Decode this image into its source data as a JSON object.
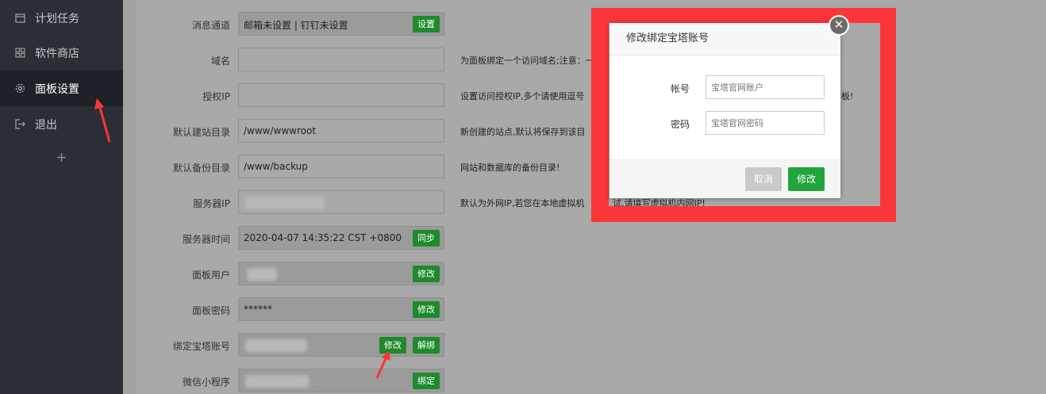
{
  "sidebar": {
    "items": [
      {
        "label": "计划任务",
        "icon": "calendar-icon"
      },
      {
        "label": "软件商店",
        "icon": "grid-icon"
      },
      {
        "label": "面板设置",
        "icon": "gear-icon"
      },
      {
        "label": "退出",
        "icon": "logout-icon"
      }
    ],
    "add_label": "+"
  },
  "settings": [
    {
      "label": "消息通道",
      "value": "邮箱未设置 | 钉钉未设置",
      "buttons": [
        "设置"
      ],
      "tip": ""
    },
    {
      "label": "域名",
      "value": "",
      "buttons": [],
      "tip": "为面板绑定一个访问域名;注意：一旦"
    },
    {
      "label": "授权IP",
      "value": "",
      "buttons": [],
      "tip": "设置访问授权IP,多个请使用逗号"
    },
    {
      "label": "默认建站目录",
      "value": "/www/wwwroot",
      "buttons": [],
      "tip": "新创建的站点,默认将保存到该目"
    },
    {
      "label": "默认备份目录",
      "value": "/www/backup",
      "buttons": [],
      "tip": "网站和数据库的备份目录!"
    },
    {
      "label": "服务器IP",
      "value": "",
      "buttons": [],
      "tip": "默认为外网IP,若您在本地虚拟机"
    },
    {
      "label": "服务器时间",
      "value": "2020-04-07 14:35:22 CST +0800",
      "buttons": [
        "同步"
      ],
      "tip": ""
    },
    {
      "label": "面板用户",
      "value": "",
      "buttons": [
        "修改"
      ],
      "tip": ""
    },
    {
      "label": "面板密码",
      "value": "******",
      "buttons": [
        "修改"
      ],
      "tip": ""
    },
    {
      "label": "绑定宝塔账号",
      "value": "",
      "buttons": [
        "修改",
        "解绑"
      ],
      "tip": ""
    },
    {
      "label": "微信小程序",
      "value": "",
      "buttons": [
        "绑定"
      ],
      "tip": ""
    }
  ],
  "tips_tail": {
    "ip_suffix": "板!",
    "server_ip_suffix": "试,请填写虚拟机内网IP!"
  },
  "modal": {
    "title": "修改绑定宝塔账号",
    "close_icon": "close-icon",
    "account_label": "帐号",
    "account_placeholder": "宝塔官网账户",
    "password_label": "密码",
    "password_placeholder": "宝塔官网密码",
    "cancel_label": "取消",
    "confirm_label": "修改"
  },
  "colors": {
    "accent_green": "#20a53a",
    "highlight_red": "#fb3638",
    "sidebar_bg": "#2a2e35"
  }
}
